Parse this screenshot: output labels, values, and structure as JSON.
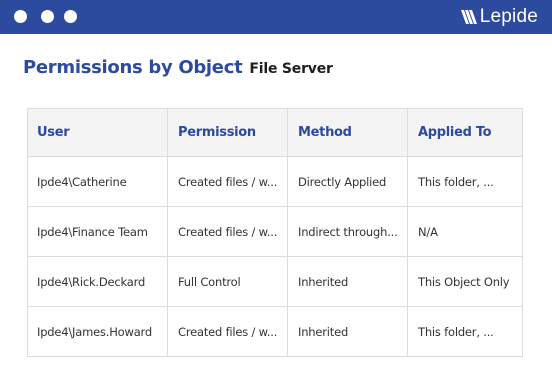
{
  "window": {
    "brand_name": "Lepide",
    "brand_icon": "lepide-logo-icon",
    "titlebar_color": "#2c4b9e"
  },
  "page": {
    "title": "Permissions by Object",
    "subtitle": "File Server"
  },
  "table": {
    "headers": [
      "User",
      "Permission",
      "Method",
      "Applied To"
    ],
    "rows": [
      [
        "Ipde4\\Catherine",
        "Created files / w...",
        "Directly Applied",
        "This folder, ..."
      ],
      [
        "Ipde4\\Finance Team",
        "Created files / w...",
        "Indirect through...",
        "N/A"
      ],
      [
        "Ipde4\\Rick.Deckard",
        "Full Control",
        "Inherited",
        "This Object Only"
      ],
      [
        "Ipde4\\James.Howard",
        "Created files / w...",
        "Inherited",
        "This folder, ..."
      ]
    ]
  },
  "colors": {
    "accent": "#2c4b9e",
    "header_bg": "#f4f4f4",
    "border": "#dcdcdc"
  }
}
